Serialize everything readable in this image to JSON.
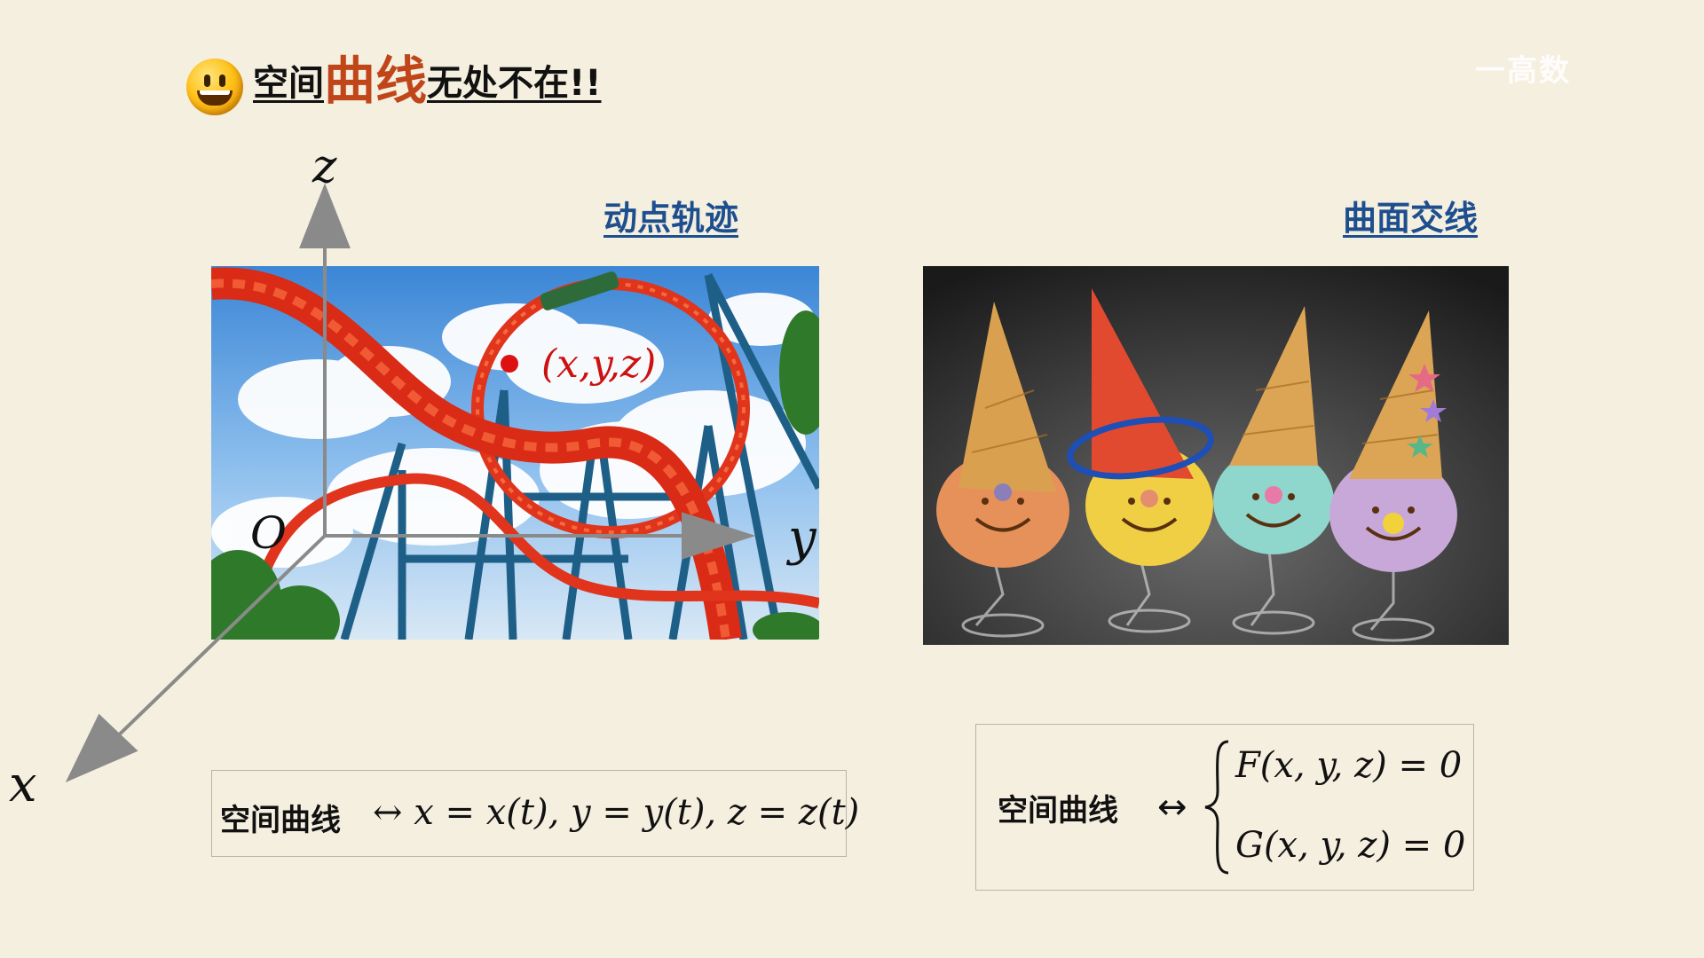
{
  "header": {
    "title_part1": "空间",
    "title_part2": "曲线",
    "title_part3": "无处不在!!",
    "watermark": "一高数"
  },
  "captions": {
    "left": "动点轨迹",
    "right": "曲面交线"
  },
  "axes": {
    "z": "z",
    "y": "y",
    "x": "x",
    "origin": "O",
    "point": "(x,y,z)"
  },
  "formula_left": {
    "label": "空间曲线",
    "expr": "↔ x = x(t), y = y(t), z = z(t)"
  },
  "formula_right": {
    "label": "空间曲线",
    "arrow": "↔",
    "eq1": "F(x, y, z) = 0",
    "eq2": "G(x, y, z) = 0"
  },
  "colors": {
    "background": "#f5efe0",
    "title_accent": "#c0461a",
    "caption": "#1d4f8f",
    "point": "#cc1111",
    "axis": "#8a8a8a"
  }
}
